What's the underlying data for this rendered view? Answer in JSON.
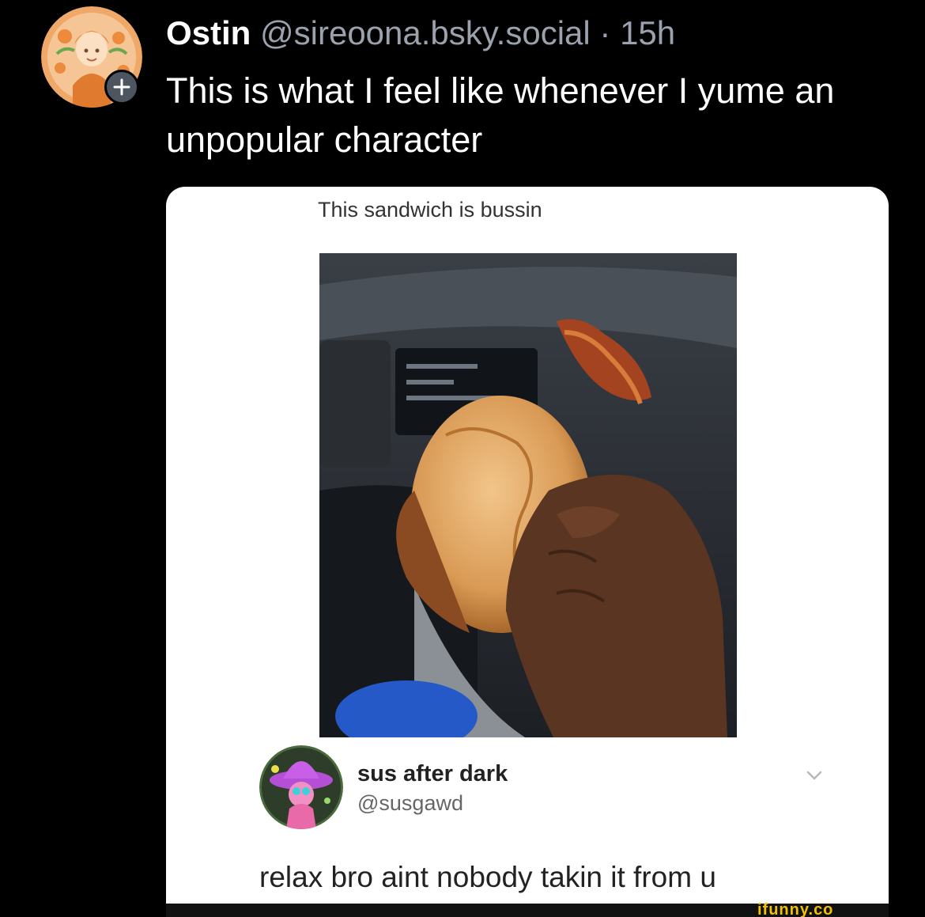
{
  "post": {
    "author": {
      "display_name": "Ostin",
      "handle": "@sireoona.bsky.social",
      "separator": "·",
      "timestamp": "15h",
      "avatar_icon": "orange-character-avatar",
      "follow_icon": "plus-icon"
    },
    "text": "This is what I feel like whenever I yume an unpopular character"
  },
  "embed": {
    "caption": "This sandwich is bussin",
    "photo_icon": "sandwich-in-car-photo",
    "reply": {
      "name": "sus after dark",
      "handle": "@susgawd",
      "avatar_icon": "pink-witch-avatar",
      "chevron_icon": "chevron-down-icon",
      "text": "relax bro aint nobody takin it from u"
    },
    "watermark": "ifunny.co"
  },
  "colors": {
    "background": "#000000",
    "text_primary": "#ffffff",
    "text_secondary": "#9aa3ad",
    "card_background": "#ffffff",
    "follow_button": "#4d5560",
    "watermark": "#f2c200"
  }
}
